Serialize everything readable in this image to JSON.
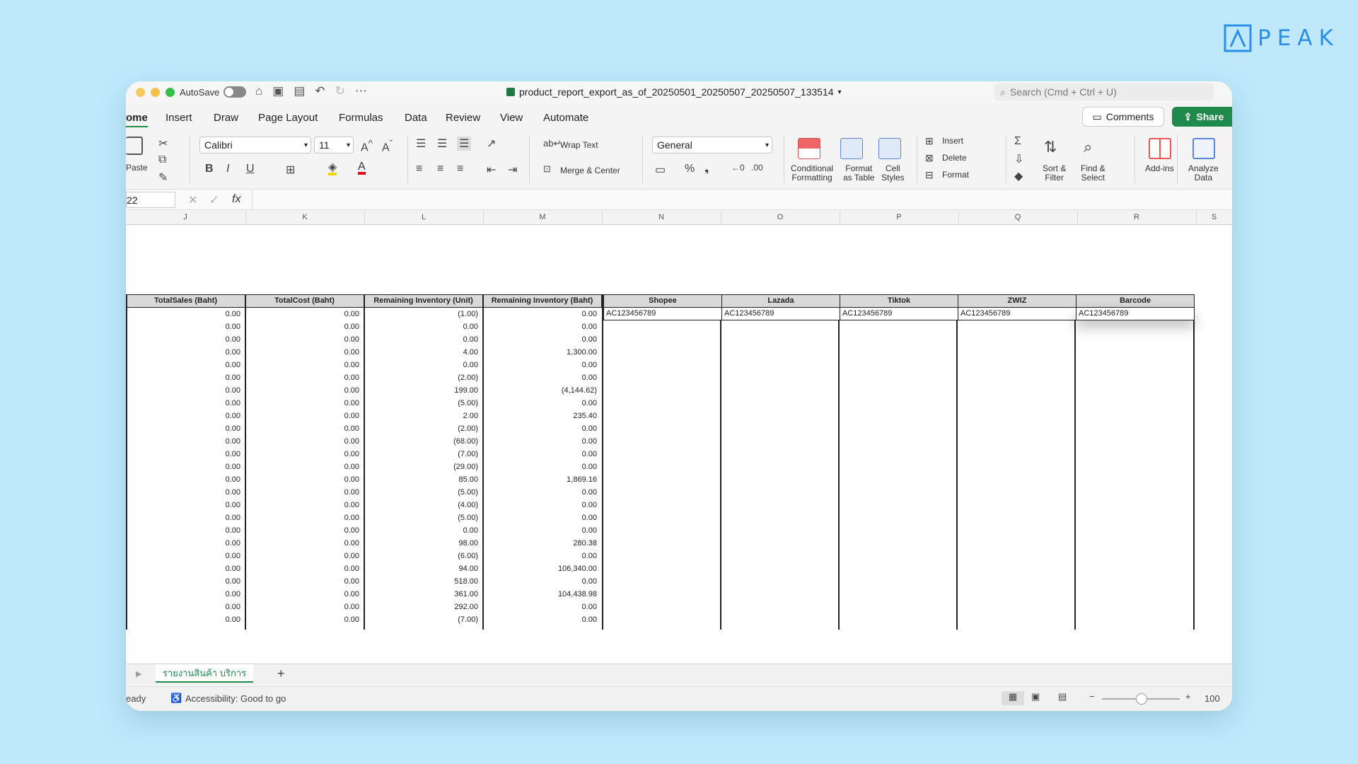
{
  "brand": {
    "name": "PEAK",
    "color": "#2a8fe8"
  },
  "titlebar": {
    "autosave_label": "AutoSave",
    "doc_title": "product_report_export_as_of_20250501_20250507_20250507_133514",
    "search_placeholder": "Search (Cmd + Ctrl + U)"
  },
  "menu": {
    "tabs": [
      "ome",
      "Insert",
      "Draw",
      "Page Layout",
      "Formulas",
      "Data",
      "Review",
      "View",
      "Automate"
    ],
    "comments": "Comments",
    "share": "Share"
  },
  "ribbon": {
    "paste": "Paste",
    "font": "Calibri",
    "font_size": "11",
    "wrap_text": "Wrap Text",
    "merge_center": "Merge & Center",
    "number_format": "General",
    "conditional_formatting": "Conditional\nFormatting",
    "format_as_table": "Format\nas Table",
    "cell_styles": "Cell\nStyles",
    "insert": "Insert",
    "delete": "Delete",
    "format": "Format",
    "sort_filter": "Sort &\nFilter",
    "find_select": "Find &\nSelect",
    "add_ins": "Add-ins",
    "analyze_data": "Analyze\nData"
  },
  "formula_bar": {
    "name_box": "22",
    "fx": "fx",
    "content": ""
  },
  "columns": [
    "J",
    "K",
    "L",
    "M",
    "N",
    "O",
    "P",
    "Q",
    "R",
    "S"
  ],
  "table": {
    "headers": [
      "TotalSales (Baht)",
      "TotalCost (Baht)",
      "Remaining Inventory (Unit)",
      "Remaining Inventory (Baht)",
      "Shopee",
      "Lazada",
      "Tiktok",
      "ZWIZ",
      "Barcode"
    ],
    "sku_values": [
      "AC123456789",
      "AC123456789",
      "AC123456789",
      "AC123456789",
      "AC123456789"
    ],
    "rows": [
      [
        "0.00",
        "0.00",
        "(1.00)",
        "0.00"
      ],
      [
        "0.00",
        "0.00",
        "0.00",
        "0.00"
      ],
      [
        "0.00",
        "0.00",
        "0.00",
        "0.00"
      ],
      [
        "0.00",
        "0.00",
        "4.00",
        "1,300.00"
      ],
      [
        "0.00",
        "0.00",
        "0.00",
        "0.00"
      ],
      [
        "0.00",
        "0.00",
        "(2.00)",
        "0.00"
      ],
      [
        "0.00",
        "0.00",
        "199.00",
        "(4,144.62)"
      ],
      [
        "0.00",
        "0.00",
        "(5.00)",
        "0.00"
      ],
      [
        "0.00",
        "0.00",
        "2.00",
        "235.40"
      ],
      [
        "0.00",
        "0.00",
        "(2.00)",
        "0.00"
      ],
      [
        "0.00",
        "0.00",
        "(68.00)",
        "0.00"
      ],
      [
        "0.00",
        "0.00",
        "(7.00)",
        "0.00"
      ],
      [
        "0.00",
        "0.00",
        "(29.00)",
        "0.00"
      ],
      [
        "0.00",
        "0.00",
        "85.00",
        "1,869.16"
      ],
      [
        "0.00",
        "0.00",
        "(5.00)",
        "0.00"
      ],
      [
        "0.00",
        "0.00",
        "(4.00)",
        "0.00"
      ],
      [
        "0.00",
        "0.00",
        "(5.00)",
        "0.00"
      ],
      [
        "0.00",
        "0.00",
        "0.00",
        "0.00"
      ],
      [
        "0.00",
        "0.00",
        "98.00",
        "280.38"
      ],
      [
        "0.00",
        "0.00",
        "(6.00)",
        "0.00"
      ],
      [
        "0.00",
        "0.00",
        "94.00",
        "106,340.00"
      ],
      [
        "0.00",
        "0.00",
        "518.00",
        "0.00"
      ],
      [
        "0.00",
        "0.00",
        "361.00",
        "104,438.98"
      ],
      [
        "0.00",
        "0.00",
        "292.00",
        "0.00"
      ],
      [
        "0.00",
        "0.00",
        "(7.00)",
        "0.00"
      ]
    ]
  },
  "sheet": {
    "tab_label": "รายงานสินค้า บริการ",
    "add": "+"
  },
  "status": {
    "ready": "eady",
    "accessibility": "Accessibility: Good to go",
    "zoom": "100"
  }
}
